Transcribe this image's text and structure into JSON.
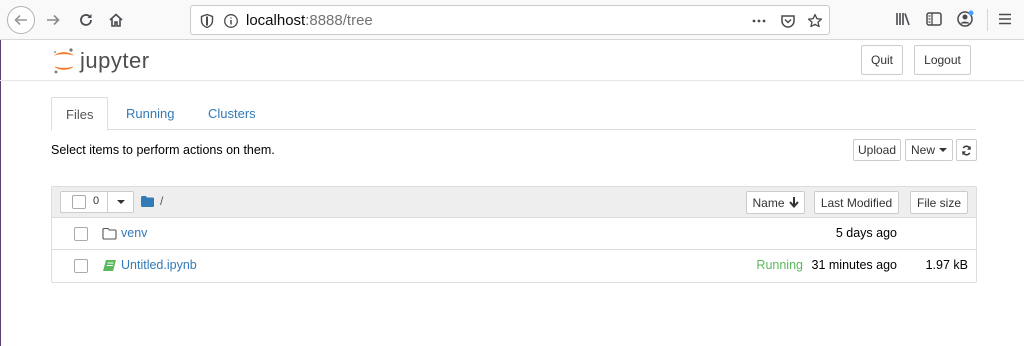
{
  "browser": {
    "url_host": "localhost",
    "url_rest": ":8888/tree",
    "icons": [
      "back-icon",
      "forward-icon",
      "reload-icon",
      "home-icon",
      "shield-icon",
      "info-icon",
      "more-icon",
      "pocket-icon",
      "star-icon",
      "library-icon",
      "sidebar-icon",
      "account-icon",
      "menu-icon"
    ]
  },
  "header": {
    "logo_text": "jupyter",
    "quit_label": "Quit",
    "logout_label": "Logout",
    "logo_colors": {
      "orange": "#f37726",
      "gray": "#767677"
    }
  },
  "tabs": [
    {
      "label": "Files",
      "active": true
    },
    {
      "label": "Running",
      "active": false
    },
    {
      "label": "Clusters",
      "active": false
    }
  ],
  "toolbar": {
    "hint": "Select items to perform actions on them.",
    "upload_label": "Upload",
    "new_label": "New",
    "refresh_icon": "refresh-icon"
  },
  "list_header": {
    "selected_count": "0",
    "path": "/",
    "sort_name_label": "Name",
    "sort_modified_label": "Last Modified",
    "sort_size_label": "File size"
  },
  "files": [
    {
      "icon": "folder-icon",
      "name": "venv",
      "status": "",
      "modified": "5 days ago",
      "size": ""
    },
    {
      "icon": "notebook-icon",
      "name": "Untitled.ipynb",
      "status": "Running",
      "modified": "31 minutes ago",
      "size": "1.97 kB"
    }
  ],
  "colors": {
    "link": "#337ab7",
    "running": "#5cb85c",
    "notebook_icon": "#5cb85c"
  }
}
